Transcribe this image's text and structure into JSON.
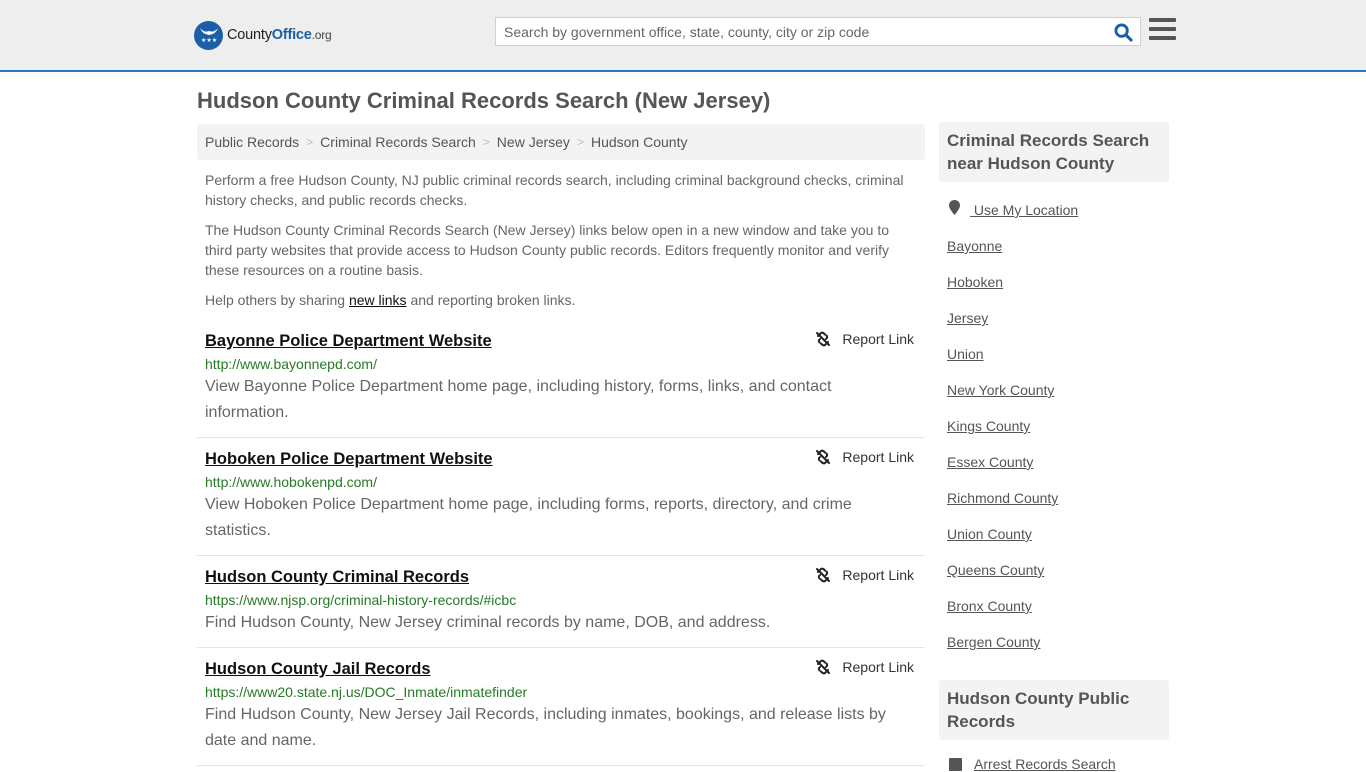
{
  "header": {
    "logo": {
      "brand_part1": "County",
      "brand_part2": "Office",
      "brand_suffix": ".org"
    },
    "search": {
      "placeholder": "Search by government office, state, county, city or zip code",
      "value": ""
    },
    "colors": {
      "accent": "#2f74b5",
      "brand": "#1a5fa8",
      "url_green": "#267a26"
    }
  },
  "page": {
    "title": "Hudson County Criminal Records Search (New Jersey)"
  },
  "breadcrumb": [
    {
      "label": "Public Records"
    },
    {
      "label": "Criminal Records Search"
    },
    {
      "label": "New Jersey"
    },
    {
      "label": "Hudson County"
    }
  ],
  "intro": {
    "p1": "Perform a free Hudson County, NJ public criminal records search, including criminal background checks, criminal history checks, and public records checks.",
    "p2": "The Hudson County Criminal Records Search (New Jersey) links below open in a new window and take you to third party websites that provide access to Hudson County public records. Editors frequently monitor and verify these resources on a routine basis.",
    "p3_before": "Help others by sharing ",
    "p3_link": "new links",
    "p3_after": " and reporting broken links."
  },
  "results": [
    {
      "title": "Bayonne Police Department Website",
      "url": "http://www.bayonnepd.com/",
      "description": "View Bayonne Police Department home page, including history, forms, links, and contact information.",
      "report_label": "Report Link"
    },
    {
      "title": "Hoboken Police Department Website",
      "url": "http://www.hobokenpd.com/",
      "description": "View Hoboken Police Department home page, including forms, reports, directory, and crime statistics.",
      "report_label": "Report Link"
    },
    {
      "title": "Hudson County Criminal Records",
      "url": "https://www.njsp.org/criminal-history-records/#icbc",
      "description": "Find Hudson County, New Jersey criminal records by name, DOB, and address.",
      "report_label": "Report Link"
    },
    {
      "title": "Hudson County Jail Records",
      "url": "https://www20.state.nj.us/DOC_Inmate/inmatefinder",
      "description": "Find Hudson County, New Jersey Jail Records, including inmates, bookings, and release lists by date and name.",
      "report_label": "Report Link"
    }
  ],
  "sidebar": {
    "nearby_heading": "Criminal Records Search near Hudson County",
    "use_location": "Use My Location",
    "nearby": [
      "Bayonne",
      "Hoboken",
      "Jersey",
      "Union",
      "New York County",
      "Kings County",
      "Essex County",
      "Richmond County",
      "Union County",
      "Queens County",
      "Bronx County",
      "Bergen County"
    ],
    "public_heading": "Hudson County Public Records",
    "public_items": [
      "Arrest Records Search"
    ]
  }
}
